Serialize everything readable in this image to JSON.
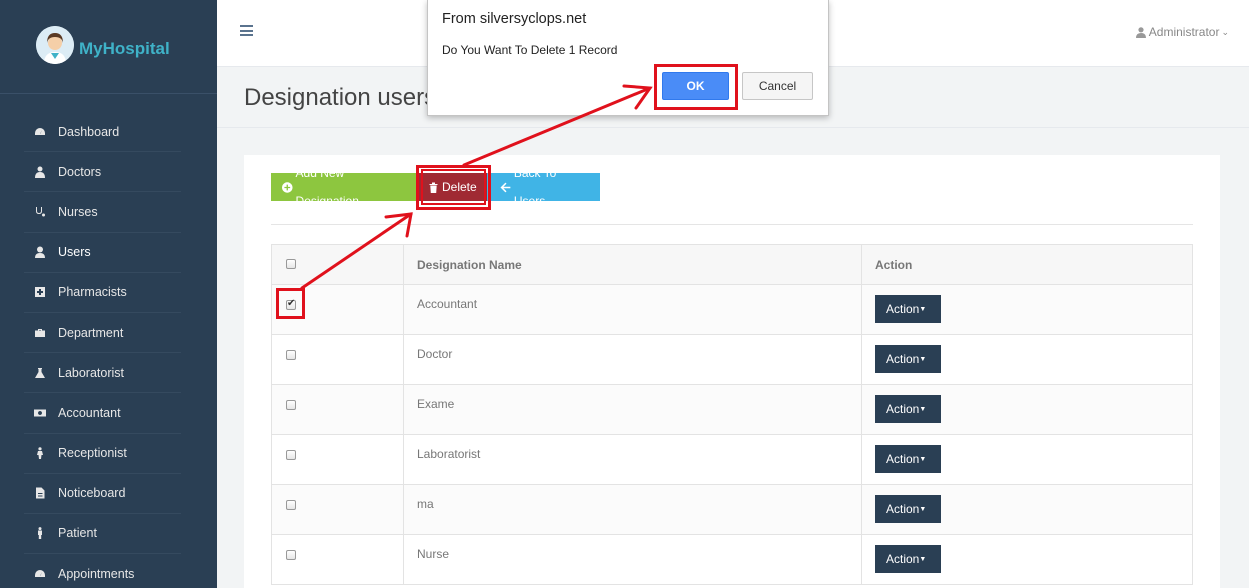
{
  "app": {
    "logo_text": "MyHospital"
  },
  "sidebar": {
    "items": [
      {
        "label": "Dashboard",
        "icon": "dashboard-icon"
      },
      {
        "label": "Doctors",
        "icon": "doctor-icon"
      },
      {
        "label": "Nurses",
        "icon": "stethoscope-icon"
      },
      {
        "label": "Users",
        "icon": "user-icon"
      },
      {
        "label": "Pharmacists",
        "icon": "plus-square-icon"
      },
      {
        "label": "Department",
        "icon": "briefcase-icon"
      },
      {
        "label": "Laboratorist",
        "icon": "flask-icon"
      },
      {
        "label": "Accountant",
        "icon": "money-icon"
      },
      {
        "label": "Receptionist",
        "icon": "person-icon"
      },
      {
        "label": "Noticeboard",
        "icon": "file-icon"
      },
      {
        "label": "Patient",
        "icon": "male-icon"
      },
      {
        "label": "Appointments",
        "icon": "dashboard-icon"
      }
    ]
  },
  "header": {
    "user": "Administrator"
  },
  "page": {
    "title": "Designation users"
  },
  "toolbar": {
    "add_label": "Add New Designation",
    "delete_label": "Delete",
    "back_label": "Back To Users"
  },
  "table": {
    "headers": [
      "",
      "Designation Name",
      "Action"
    ],
    "rows": [
      {
        "name": "Accountant",
        "checked": true,
        "action": "Action"
      },
      {
        "name": "Doctor",
        "checked": false,
        "action": "Action"
      },
      {
        "name": "Exame",
        "checked": false,
        "action": "Action"
      },
      {
        "name": "Laboratorist",
        "checked": false,
        "action": "Action"
      },
      {
        "name": "ma",
        "checked": false,
        "action": "Action"
      },
      {
        "name": "Nurse",
        "checked": false,
        "action": "Action"
      }
    ]
  },
  "dialog": {
    "title": "From silversyclops.net",
    "message": "Do You Want To Delete 1 Record",
    "ok_label": "OK",
    "cancel_label": "Cancel"
  },
  "colors": {
    "sidebar": "#2a3f54",
    "annotation": "#e0111c",
    "add": "#8dc63f",
    "delete": "#a02a33",
    "back": "#40b4e6"
  }
}
